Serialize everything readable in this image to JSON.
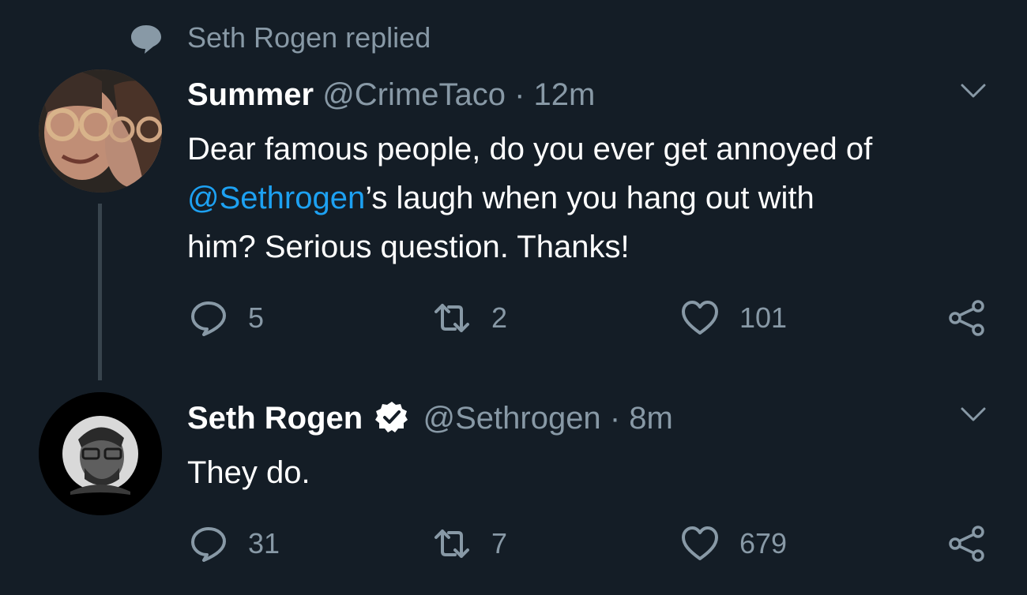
{
  "context": {
    "text": "Seth Rogen replied",
    "icon": "speech-bubble-icon"
  },
  "colors": {
    "background": "#141d26",
    "secondary_text": "#8899a6",
    "link": "#1da1f2",
    "thread_line": "#38444d"
  },
  "tweets": [
    {
      "display_name": "Summer",
      "handle": "@CrimeTaco",
      "separator": "·",
      "timestamp": "12m",
      "verified": false,
      "text": {
        "line1": "Dear famous people, do you ever get annoyed of",
        "mention": "@Sethrogen",
        "line2_rest": "’s laugh when you hang out with",
        "line3": "him? Serious question. Thanks!"
      },
      "actions": {
        "replies": "5",
        "retweets": "2",
        "likes": "101"
      }
    },
    {
      "display_name": "Seth Rogen",
      "handle": "@Sethrogen",
      "separator": "·",
      "timestamp": "8m",
      "verified": true,
      "text": {
        "line1": "They do."
      },
      "actions": {
        "replies": "31",
        "retweets": "7",
        "likes": "679"
      }
    }
  ]
}
